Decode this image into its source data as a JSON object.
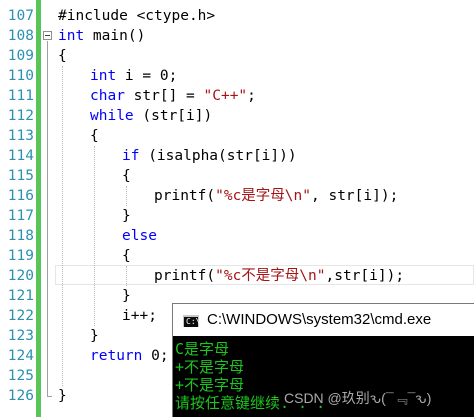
{
  "editor": {
    "line_numbers": [
      "107",
      "108",
      "109",
      "110",
      "111",
      "112",
      "113",
      "114",
      "115",
      "116",
      "117",
      "118",
      "119",
      "120",
      "121",
      "122",
      "123",
      "124",
      "125",
      "126"
    ],
    "lines": {
      "l107": {
        "code": "#include <ctype.h>"
      },
      "l108": {
        "kw": "int",
        "rest": " main()"
      },
      "l109": {
        "code": "{"
      },
      "l110": {
        "kw": "int",
        "rest": " i = 0;"
      },
      "l111": {
        "kw": "char",
        "mid": " str[] = ",
        "str": "\"C++\"",
        "end": ";"
      },
      "l112": {
        "kw": "while",
        "rest": " (str[i])"
      },
      "l113": {
        "code": "{"
      },
      "l114": {
        "kw": "if",
        "rest": " (isalpha(str[i]))"
      },
      "l115": {
        "code": "{"
      },
      "l116": {
        "pre": "printf(",
        "str": "\"%c是字母\\n\"",
        "end": ", str[i]);"
      },
      "l117": {
        "code": "}"
      },
      "l118": {
        "kw": "else"
      },
      "l119": {
        "code": "{"
      },
      "l120": {
        "pre": "printf(",
        "str": "\"%c不是字母\\n\"",
        "end": ",str[i]);"
      },
      "l121": {
        "code": "}"
      },
      "l122": {
        "code": "i++;"
      },
      "l123": {
        "code": "}"
      },
      "l124": {
        "kw": "return",
        "rest": " 0;"
      },
      "l125": {
        "code": ""
      },
      "l126": {
        "code": "}"
      }
    }
  },
  "console": {
    "title": "C:\\WINDOWS\\system32\\cmd.exe",
    "icon_text": "C:\\",
    "output": [
      "C是字母",
      "+不是字母",
      "+不是字母",
      "请按任意键继续. . ."
    ]
  },
  "watermark": "CSDN @玖别ԅ(¯﹃¯ԅ)",
  "colors": {
    "line_number": "#2b91af",
    "keyword": "#0000ff",
    "string": "#a31515",
    "gutter_marker": "#57c557",
    "console_text": "#1ec51e",
    "console_bg": "#000000"
  }
}
